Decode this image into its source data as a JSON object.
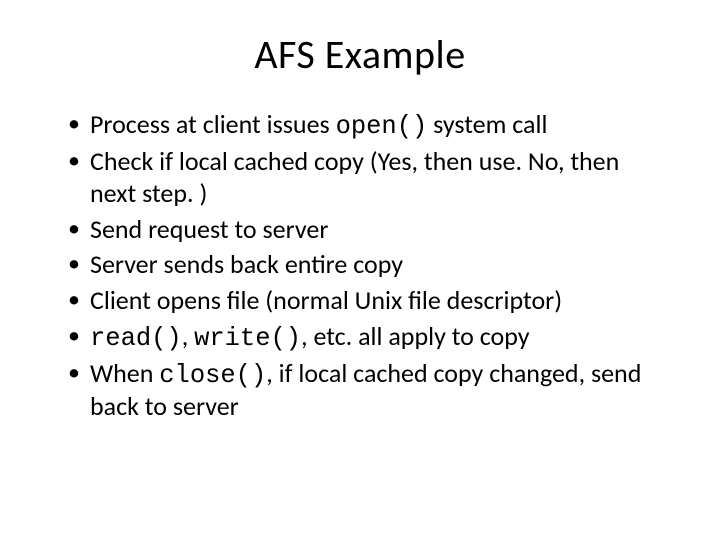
{
  "title": "AFS Example",
  "bullets": [
    {
      "pre": "Process at client issues ",
      "code": "open()",
      "post": " system call"
    },
    {
      "pre": "Check if local cached copy (Yes, then use.  No, then next step. )",
      "code": "",
      "post": ""
    },
    {
      "pre": "Send request to server",
      "code": "",
      "post": ""
    },
    {
      "pre": "Server sends back entire copy",
      "code": "",
      "post": ""
    },
    {
      "pre": "Client opens file (normal Unix file descriptor)",
      "code": "",
      "post": ""
    },
    {
      "pre": "",
      "code": "read()",
      "mid": ", ",
      "code2": "write()",
      "post": ", etc. all apply to copy"
    },
    {
      "pre": "When ",
      "code": "close()",
      "post": ", if local cached copy changed, send back to server"
    }
  ]
}
